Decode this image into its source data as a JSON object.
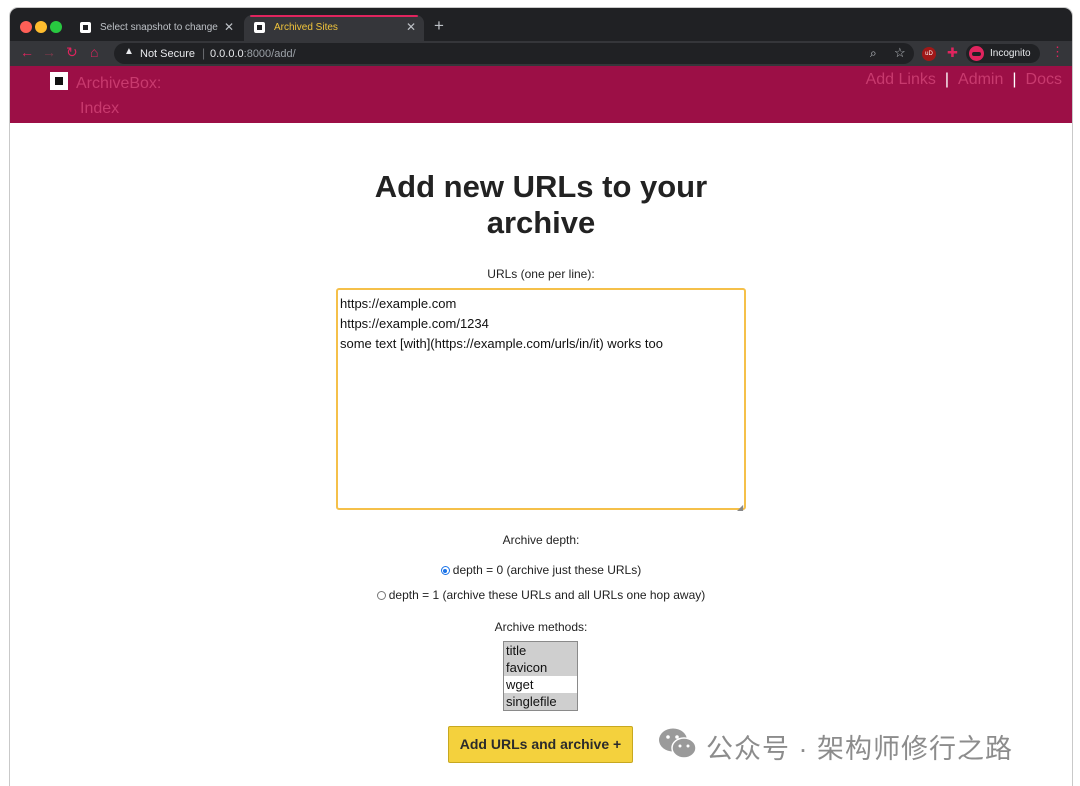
{
  "browser": {
    "tabs": [
      {
        "title": "Select snapshot to change | In",
        "active": false
      },
      {
        "title": "Archived Sites",
        "active": true
      }
    ],
    "new_tab_icon": "+",
    "security_label": "Not Secure",
    "url_host": "0.0.0.0",
    "url_rest": ":8000/add/",
    "incognito_label": "Incognito",
    "extension_label": "uD"
  },
  "header": {
    "brand_line1": "ArchiveBox:",
    "brand_line2": "Index",
    "links": [
      "Add Links",
      "Admin",
      "Docs"
    ],
    "separator": "|",
    "background_color": "#9c0f46"
  },
  "form": {
    "title_line1": "Add new URLs to your",
    "title_line2": "archive",
    "urls_label": "URLs (one per line):",
    "urls_value": "https://example.com\nhttps://example.com/1234\nsome text [with](https://example.com/urls/in/it) works too",
    "depth_label": "Archive depth:",
    "depth_options": [
      {
        "label": "depth = 0 (archive just these URLs)",
        "checked": true
      },
      {
        "label": "depth = 1 (archive these URLs and all URLs one hop away)",
        "checked": false
      }
    ],
    "methods_label": "Archive methods:",
    "methods": [
      {
        "label": "title",
        "selected": true
      },
      {
        "label": "favicon",
        "selected": true
      },
      {
        "label": "wget",
        "selected": false
      },
      {
        "label": "singlefile",
        "selected": true
      }
    ],
    "submit_label": "Add URLs and archive",
    "submit_icon": "+",
    "accent_color": "#f4d13d"
  },
  "watermark": {
    "text": "公众号 · 架构师修行之路"
  }
}
